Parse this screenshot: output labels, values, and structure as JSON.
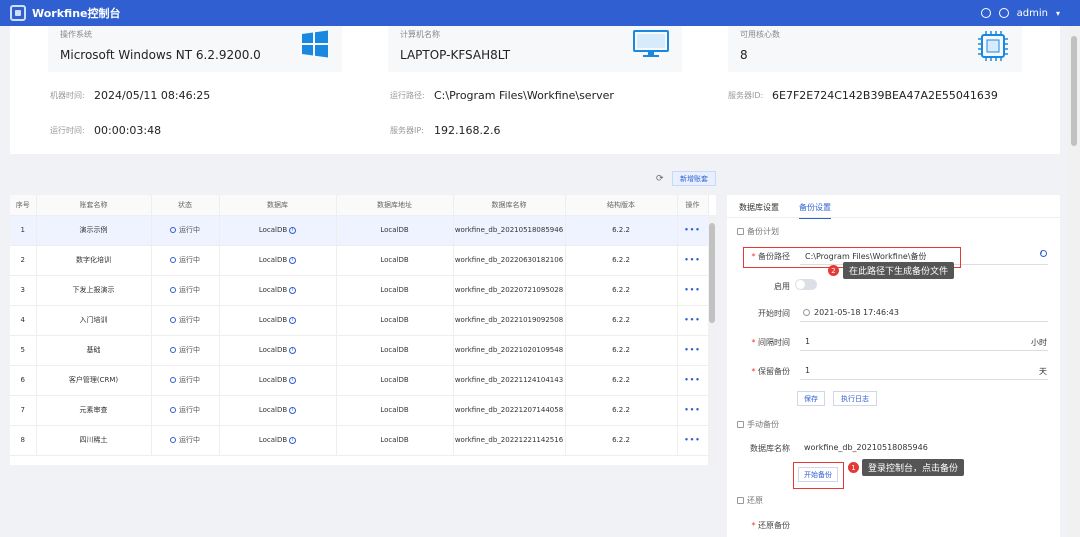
{
  "app": {
    "title": "Workfine控制台",
    "user": "admin"
  },
  "stats": [
    {
      "label": "操作系统",
      "value": "Microsoft Windows NT 6.2.9200.0",
      "icon": "windows-icon"
    },
    {
      "label": "计算机名称",
      "value": "LAPTOP-KFSAH8LT",
      "icon": "monitor-icon"
    },
    {
      "label": "可用核心数",
      "value": "8",
      "icon": "cpu-icon"
    }
  ],
  "details": {
    "machine_time_label": "机器时间:",
    "machine_time": "2024/05/11 08:46:25",
    "run_path_label": "运行路径:",
    "run_path": "C:\\Program Files\\Workfine\\server",
    "server_id_label": "服务器ID:",
    "server_id": "6E7F2E724C142B39BEA47A2E55041639",
    "uptime_label": "运行时间:",
    "uptime": "00:00:03:48",
    "server_ip_label": "服务器IP:",
    "server_ip": "192.168.2.6"
  },
  "toolbar": {
    "add_label": "新增账套"
  },
  "table": {
    "headers": [
      "序号",
      "账套名称",
      "状态",
      "数据库",
      "数据库地址",
      "数据库名称",
      "结构版本",
      "操作"
    ],
    "rows": [
      {
        "no": "1",
        "name": "演示示例",
        "status": "运行中",
        "db": "LocalDB",
        "addr": "LocalDB",
        "dbname": "workfine_db_20210518085946",
        "ver": "6.2.2",
        "ops": "•••"
      },
      {
        "no": "2",
        "name": "数字化培训",
        "status": "运行中",
        "db": "LocalDB",
        "addr": "LocalDB",
        "dbname": "workfine_db_20220630182106",
        "ver": "6.2.2",
        "ops": "•••"
      },
      {
        "no": "3",
        "name": "下发上报演示",
        "status": "运行中",
        "db": "LocalDB",
        "addr": "LocalDB",
        "dbname": "workfine_db_20220721095028",
        "ver": "6.2.2",
        "ops": "•••"
      },
      {
        "no": "4",
        "name": "入门培训",
        "status": "运行中",
        "db": "LocalDB",
        "addr": "LocalDB",
        "dbname": "workfine_db_20221019092508",
        "ver": "6.2.2",
        "ops": "•••"
      },
      {
        "no": "5",
        "name": "基础",
        "status": "运行中",
        "db": "LocalDB",
        "addr": "LocalDB",
        "dbname": "workfine_db_20221020109548",
        "ver": "6.2.2",
        "ops": "•••"
      },
      {
        "no": "6",
        "name": "客户管理(CRM)",
        "status": "运行中",
        "db": "LocalDB",
        "addr": "LocalDB",
        "dbname": "workfine_db_20221124104143",
        "ver": "6.2.2",
        "ops": "•••"
      },
      {
        "no": "7",
        "name": "元素审查",
        "status": "运行中",
        "db": "LocalDB",
        "addr": "LocalDB",
        "dbname": "workfine_db_20221207144058",
        "ver": "6.2.2",
        "ops": "•••"
      },
      {
        "no": "8",
        "name": "四川稀土",
        "status": "运行中",
        "db": "LocalDB",
        "addr": "LocalDB",
        "dbname": "workfine_db_20221221142516",
        "ver": "6.2.2",
        "ops": "•••"
      }
    ]
  },
  "panel": {
    "tabs": [
      "数据库设置",
      "备份设置"
    ],
    "backup_plan": "备份计划",
    "backup_path_label": "备份路径",
    "backup_path": "C:\\Program Files\\Workfine\\备份",
    "enable_label": "启用",
    "start_time_label": "开始时间",
    "start_time": "2021-05-18 17:46:43",
    "interval_label": "间隔时间",
    "interval": "1",
    "interval_unit": "小时",
    "keep_label": "保留备份",
    "keep": "1",
    "keep_unit": "天",
    "save_label": "保存",
    "log_label": "执行日志",
    "manual_backup": "手动备份",
    "db_name_label": "数据库名称",
    "db_name": "workfine_db_20210518085946",
    "start_backup_label": "开始备份",
    "restore": "还原",
    "restore_backup_label": "还原备份"
  },
  "annotations": {
    "tip1": "登录控制台，点击备份",
    "tip1_num": "1",
    "tip2": "在此路径下生成备份文件",
    "tip2_num": "2"
  },
  "colors": {
    "brand": "#2f5fd0",
    "annotation": "#e53935"
  }
}
